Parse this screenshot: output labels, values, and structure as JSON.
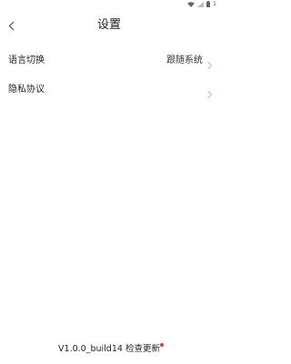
{
  "status_bar": {
    "time": "1",
    "icons": [
      "wifi-icon",
      "signal-icon",
      "battery-icon"
    ]
  },
  "header": {
    "back_icon": "chevron-left-icon",
    "title": "设置"
  },
  "settings": {
    "items": [
      {
        "label": "语言切换",
        "value": "跟随系统",
        "icon": "chevron-right-icon"
      },
      {
        "label": "隐私协议",
        "value": "",
        "icon": "chevron-right-icon"
      }
    ]
  },
  "footer": {
    "version_text": "V1.0.0_build14",
    "check_update_label": "检查更新",
    "badge_color": "#e53935"
  }
}
